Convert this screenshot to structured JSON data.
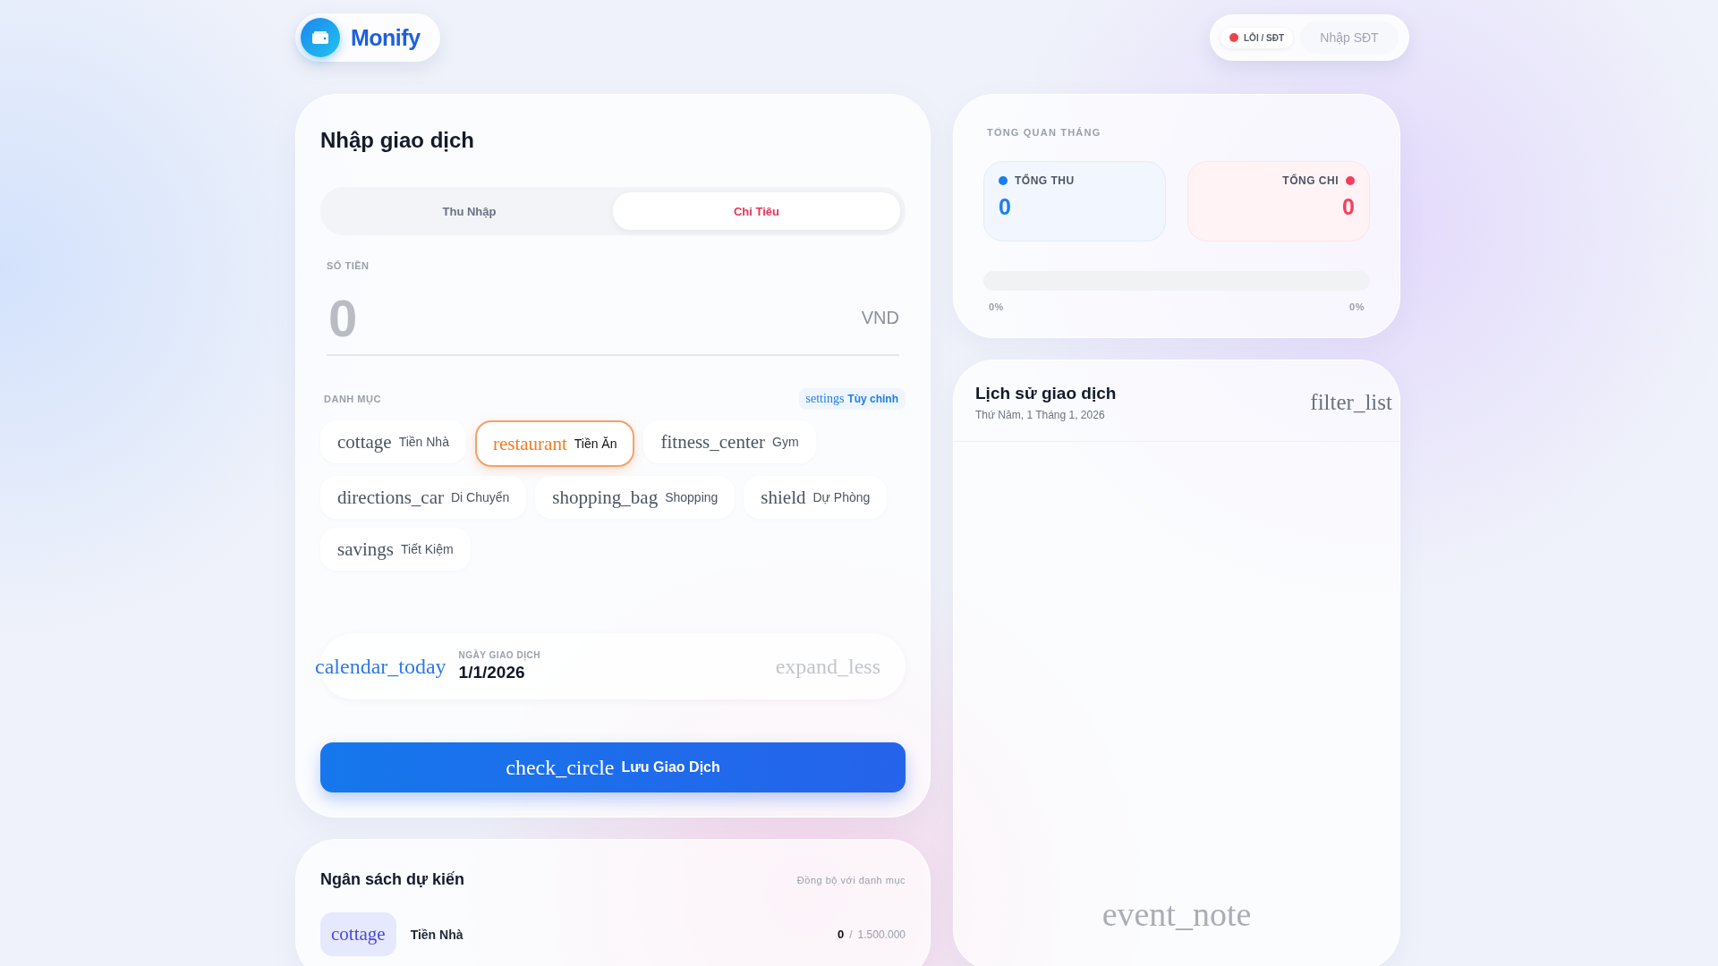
{
  "header": {
    "logo": {
      "text": "Monify"
    },
    "status": {
      "label": "LỖI / SĐT",
      "color": "#ef4444"
    },
    "phone_field": {
      "placeholder": "Nhập SĐT"
    }
  },
  "entry": {
    "title": "Nhập giao dịch",
    "tabs": [
      {
        "label": "Thu Nhập",
        "selected": false
      },
      {
        "label": "Chi Tiêu",
        "selected": true
      }
    ],
    "amount": {
      "label": "SỐ TIỀN",
      "placeholder": "0",
      "currency": "VND"
    },
    "categories": {
      "label": "DANH MỤC",
      "customize": {
        "icon": "settings",
        "label": "Tùy chỉnh"
      },
      "items": [
        {
          "icon": "cottage",
          "label": "Tiền Nhà",
          "selected": false
        },
        {
          "icon": "restaurant",
          "label": "Tiền Ăn",
          "selected": true
        },
        {
          "icon": "fitness_center",
          "label": "Gym",
          "selected": false
        },
        {
          "icon": "directions_car",
          "label": "Di Chuyển",
          "selected": false
        },
        {
          "icon": "shopping_bag",
          "label": "Shopping",
          "selected": false
        },
        {
          "icon": "shield",
          "label": "Dự Phòng",
          "selected": false
        },
        {
          "icon": "savings",
          "label": "Tiết Kiệm",
          "selected": false
        }
      ]
    },
    "date": {
      "icon": "calendar_today",
      "label": "NGÀY GIAO DỊCH",
      "value": "1/1/2026",
      "toggle_icon": "expand_less"
    },
    "save_button": {
      "icon": "check_circle",
      "label": "Lưu Giao Dịch"
    }
  },
  "budget": {
    "title": "Ngân sách dự kiến",
    "sync_label": "Đồng bộ với danh mục",
    "items": [
      {
        "icon": "cottage",
        "label": "Tiền Nhà",
        "spent": "0",
        "separator": "/",
        "limit": "1.500.000"
      }
    ]
  },
  "overview": {
    "title": "TỔNG QUAN THÁNG",
    "totals": [
      {
        "label": "TỔNG THU",
        "value": "0",
        "color": "#1a7ef0"
      },
      {
        "label": "TỔNG CHI",
        "value": "0",
        "color": "#f43f5e"
      }
    ],
    "progress": {
      "level": 0
    },
    "left_percent": "0%",
    "right_percent": "0%"
  },
  "history": {
    "title": "Lịch sử giao dịch",
    "date": "Thứ Năm, 1 Tháng 1, 2026",
    "filter_icon": "filter_list",
    "empty_icon": "event_note"
  }
}
